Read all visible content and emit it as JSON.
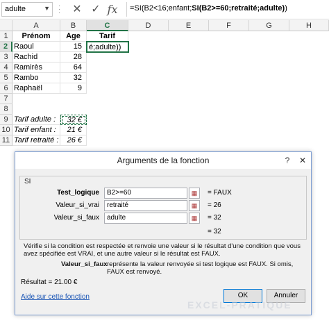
{
  "formula_bar": {
    "name_box": "adulte",
    "formula_prefix": "=SI(B2<16;enfant;",
    "formula_bold": "SI(B2>=60;retraité;adulte)",
    "formula_suffix": ")",
    "cancel_glyph": "✕",
    "enter_glyph": "✓",
    "fx_glyph": "fx"
  },
  "columns": [
    "A",
    "B",
    "C",
    "D",
    "E",
    "F",
    "G",
    "H"
  ],
  "rows": [
    "1",
    "2",
    "3",
    "4",
    "5",
    "6",
    "7",
    "8",
    "9",
    "10",
    "11",
    "12"
  ],
  "sheet": {
    "header": {
      "prenom": "Prénom",
      "age": "Age",
      "tarif": "Tarif"
    },
    "people": [
      {
        "name": "Raoul",
        "age": "15"
      },
      {
        "name": "Rachid",
        "age": "28"
      },
      {
        "name": "Ramirès",
        "age": "64"
      },
      {
        "name": "Rambo",
        "age": "32"
      },
      {
        "name": "Raphaël",
        "age": "9"
      }
    ],
    "active_cell_text": "é;adulte))",
    "tarifs": [
      {
        "label": "Tarif adulte :",
        "value": "32 €"
      },
      {
        "label": "Tarif enfant :",
        "value": "21 €"
      },
      {
        "label": "Tarif retraité :",
        "value": "26 €"
      }
    ]
  },
  "dialog": {
    "title": "Arguments de la fonction",
    "help_glyph": "?",
    "close_glyph": "✕",
    "function_name": "SI",
    "args": [
      {
        "label": "Test_logique",
        "value": "B2>=60",
        "result": "=  FAUX"
      },
      {
        "label": "Valeur_si_vrai",
        "value": "retraité",
        "result": "=  26"
      },
      {
        "label": "Valeur_si_faux",
        "value": "adulte",
        "result": "=  32"
      }
    ],
    "total_result": "=  32",
    "description": "Vérifie si la condition est respectée et renvoie une valeur si le résultat d'une condition que vous avez spécifiée est VRAI, et une autre valeur si le résultat est FAUX.",
    "arg_detail_name": "Valeur_si_faux",
    "arg_detail_text": "représente la valeur renvoyée si test logique est FAUX. Si omis, FAUX est renvoyé.",
    "result_line": "Résultat =   21.00 €",
    "help_link": "Aide sur cette fonction",
    "ok_label": "OK",
    "cancel_label": "Annuler"
  },
  "watermark": "EXCEL-PRATIQUE"
}
